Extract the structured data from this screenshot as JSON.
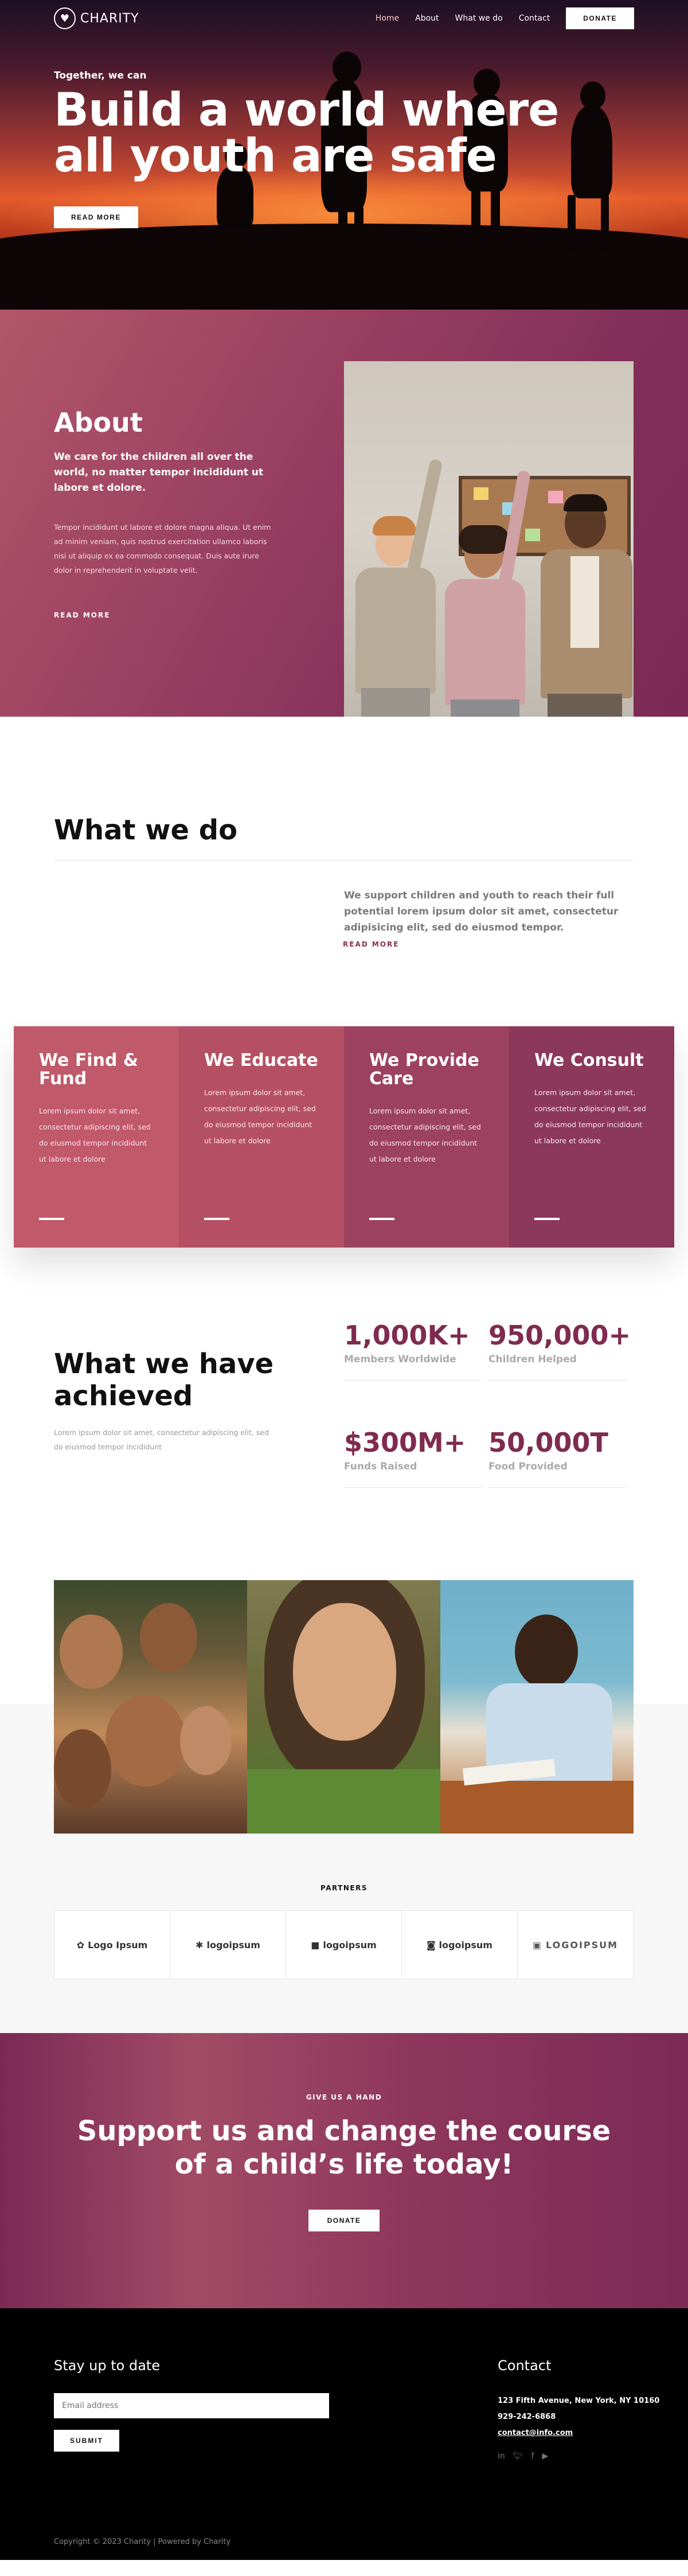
{
  "nav": {
    "brand": "CHARITY",
    "links": [
      "Home",
      "About",
      "What we do",
      "Contact"
    ],
    "donate": "DONATE"
  },
  "hero": {
    "kicker": "Together, we can",
    "title": "Build a world where all youth are safe",
    "button": "READ MORE"
  },
  "about": {
    "title": "About",
    "lead": "We care for the children all over the world, no matter tempor incididunt ut labore et dolore.",
    "body": "Tempor incididunt ut labore et dolore magna aliqua. Ut enim ad minim veniam, quis nostrud exercitation ullamco laboris nisi ut aliquip ex ea commodo consequat. Duis aute irure dolor in reprehenderit in voluptate velit.",
    "link": "READ MORE"
  },
  "whatwedo": {
    "title": "What we do",
    "text": "We support children and youth to reach their full potential lorem ipsum dolor sit amet, consectetur adipisicing elit, sed do eiusmod tempor.",
    "link": "READ MORE"
  },
  "services": [
    {
      "title": "We Find & Fund",
      "body": "Lorem ipsum dolor sit amet, consectetur adipiscing elit, sed do eiusmod tempor incididunt ut labore et dolore",
      "color": "#c0596a"
    },
    {
      "title": "We Educate",
      "body": "Lorem ipsum dolor sit amet, consectetur adipiscing elit, sed do eiusmod tempor incididunt ut labore et dolore",
      "color": "#b55064"
    },
    {
      "title": "We Provide Care",
      "body": "Lorem ipsum dolor sit amet, consectetur adipiscing elit, sed do eiusmod tempor incididunt ut labore et dolore",
      "color": "#9c4260"
    },
    {
      "title": "We Consult",
      "body": "Lorem ipsum dolor sit amet, consectetur adipiscing elit, sed do eiusmod tempor incididunt ut labore et dolore",
      "color": "#8b385b"
    }
  ],
  "achieved": {
    "title": "What we have achieved",
    "subtitle": "Lorem ipsum dolor sit amet, consectetur adipiscing elit, sed do eiusmod tempor incididunt",
    "stats": [
      {
        "value": "1,000K+",
        "label": "Members Worldwide"
      },
      {
        "value": "950,000+",
        "label": "Children Helped"
      },
      {
        "value": "$300M+",
        "label": "Funds Raised"
      },
      {
        "value": "50,000T",
        "label": "Food Provided"
      }
    ]
  },
  "partners": {
    "title": "PARTNERS",
    "logos": [
      "Logo Ipsum",
      "logoipsum",
      "logoipsum",
      "logoipsum",
      "LOGOIPSUM"
    ]
  },
  "cta": {
    "kicker": "GIVE US A HAND",
    "title": "Support us and change the course of a child’s life today!",
    "button": "DONATE"
  },
  "footer": {
    "newsletter_title": "Stay up to date",
    "email_placeholder": "Email address",
    "submit": "SUBMIT",
    "contact_title": "Contact",
    "address": "123 Fifth Avenue, New York, NY 10160",
    "phone": "929-242-6868",
    "email": "contact@info.com",
    "copyright": "Copyright © 2023 Charity | Powered by Charity"
  },
  "colors": {
    "accent": "#7f2b4f",
    "dark": "#000000"
  }
}
